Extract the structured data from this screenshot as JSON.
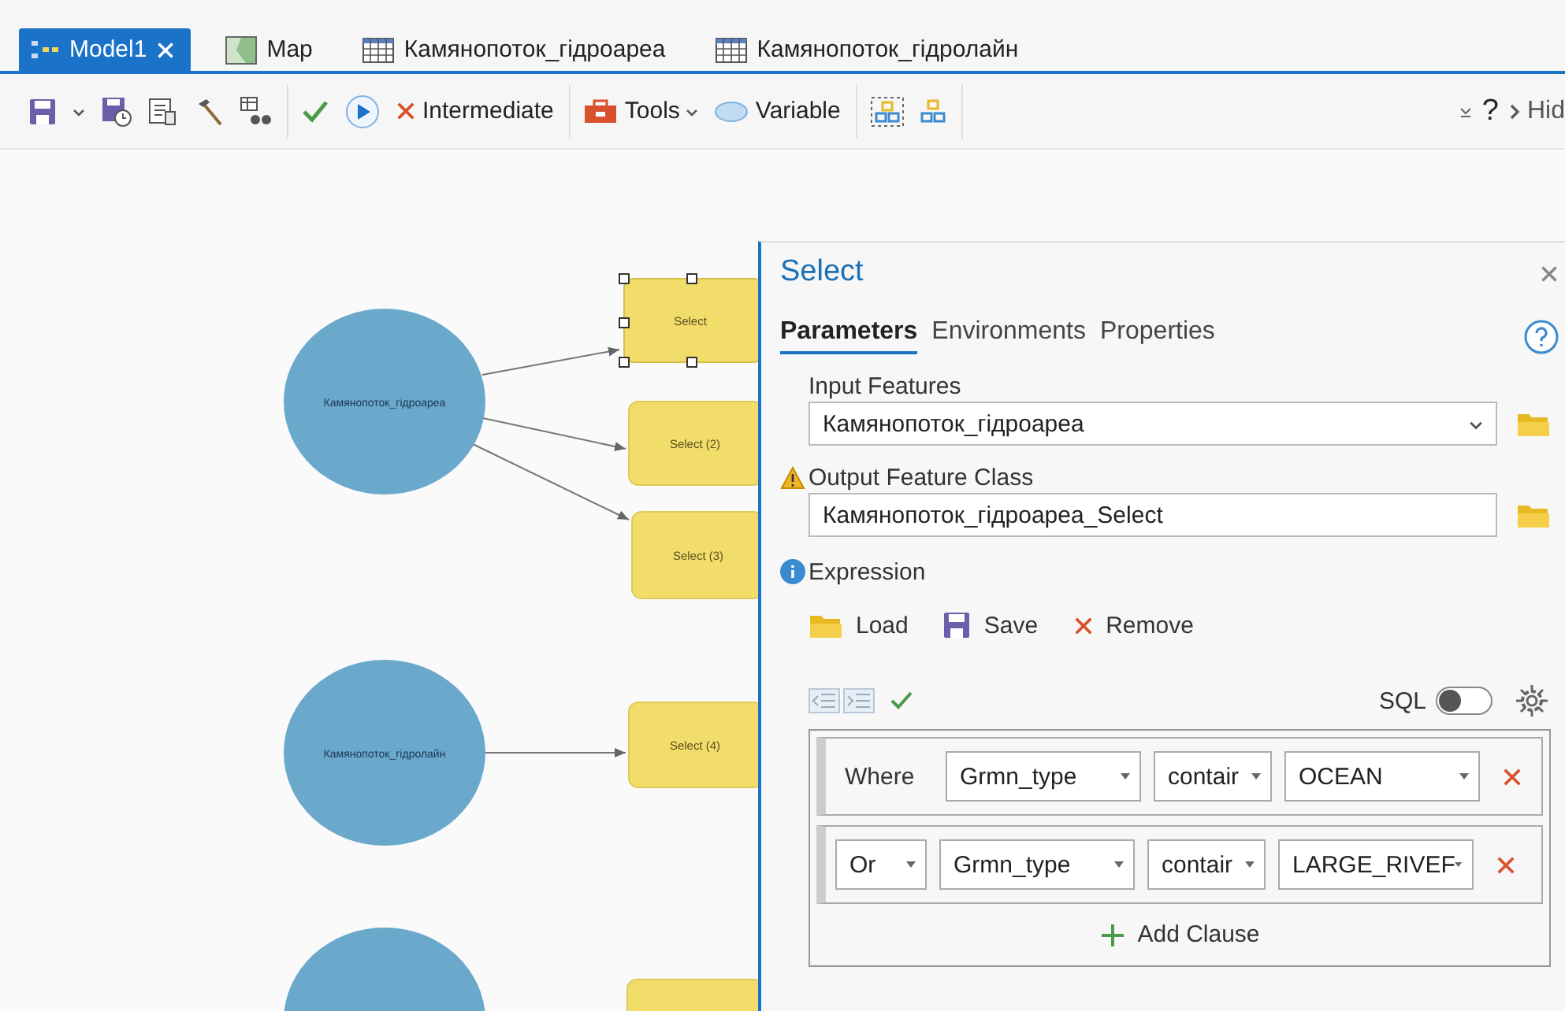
{
  "tabs": [
    {
      "label": "Model1",
      "kind": "model",
      "selected": true,
      "closable": true
    },
    {
      "label": "Map",
      "kind": "map",
      "selected": false,
      "closable": false
    },
    {
      "label": "Камянопоток_гідроареа",
      "kind": "table",
      "selected": false,
      "closable": false
    },
    {
      "label": "Камянопоток_гідролайн",
      "kind": "table",
      "selected": false,
      "closable": false
    }
  ],
  "toolbar": {
    "groups": [
      [
        {
          "kind": "save"
        },
        {
          "kind": "caret"
        },
        {
          "kind": "save-history"
        },
        {
          "kind": "report"
        },
        {
          "kind": "hammer"
        },
        {
          "kind": "binoculars"
        }
      ],
      [
        {
          "kind": "check"
        },
        {
          "kind": "run"
        },
        {
          "kind": "intermediate",
          "label": "Intermediate"
        }
      ],
      [
        {
          "kind": "tools",
          "label": "Tools",
          "caret": true
        },
        {
          "kind": "variable",
          "label": "Variable"
        }
      ],
      [
        {
          "kind": "layout-select"
        },
        {
          "kind": "layout"
        }
      ]
    ],
    "right": {
      "help": "?",
      "hide": "Hid"
    }
  },
  "diagram": {
    "data_nodes": [
      {
        "kind": "dataset",
        "label": "Камянопоток_гідроареа"
      },
      {
        "kind": "dataset",
        "label": "Камянопоток_гідролайн"
      },
      {
        "kind": "dataset"
      }
    ],
    "tool_nodes": [
      {
        "label": "Select",
        "selected": true
      },
      {
        "label": "Select (2)",
        "selected": false
      },
      {
        "label": "Select (3)",
        "selected": false
      },
      {
        "label": "Select (4)",
        "selected": false
      },
      {
        "selected": false
      }
    ]
  },
  "pane": {
    "title": "Select",
    "tabs": [
      {
        "label": "Parameters",
        "selected": true
      },
      {
        "label": "Environments",
        "selected": false
      },
      {
        "label": "Properties",
        "selected": false
      }
    ],
    "fields": [
      {
        "kind": "dropdown",
        "label": "Input Features",
        "value": "Камянопоток_гідроареа"
      },
      {
        "kind": "warning",
        "label": "Output Feature Class",
        "value": "Камянопоток_гідроареа_Select"
      }
    ],
    "expression": {
      "label": "Expression",
      "actions": [
        {
          "kind": "load",
          "label": "Load"
        },
        {
          "kind": "save",
          "label": "Save"
        },
        {
          "kind": "remove",
          "label": "Remove"
        }
      ],
      "sql_label": "SQL",
      "sql_on": false,
      "clauses": [
        {
          "connector": {
            "kind": "label",
            "text": "Where"
          },
          "field": "Grmn_type",
          "operator": "contair",
          "value": "OCEAN"
        },
        {
          "connector": {
            "kind": "dropdown",
            "text": "Or"
          },
          "field": "Grmn_type",
          "operator": "contair",
          "value": "LARGE_RIVEF"
        }
      ],
      "add_clause": "Add Clause"
    }
  }
}
